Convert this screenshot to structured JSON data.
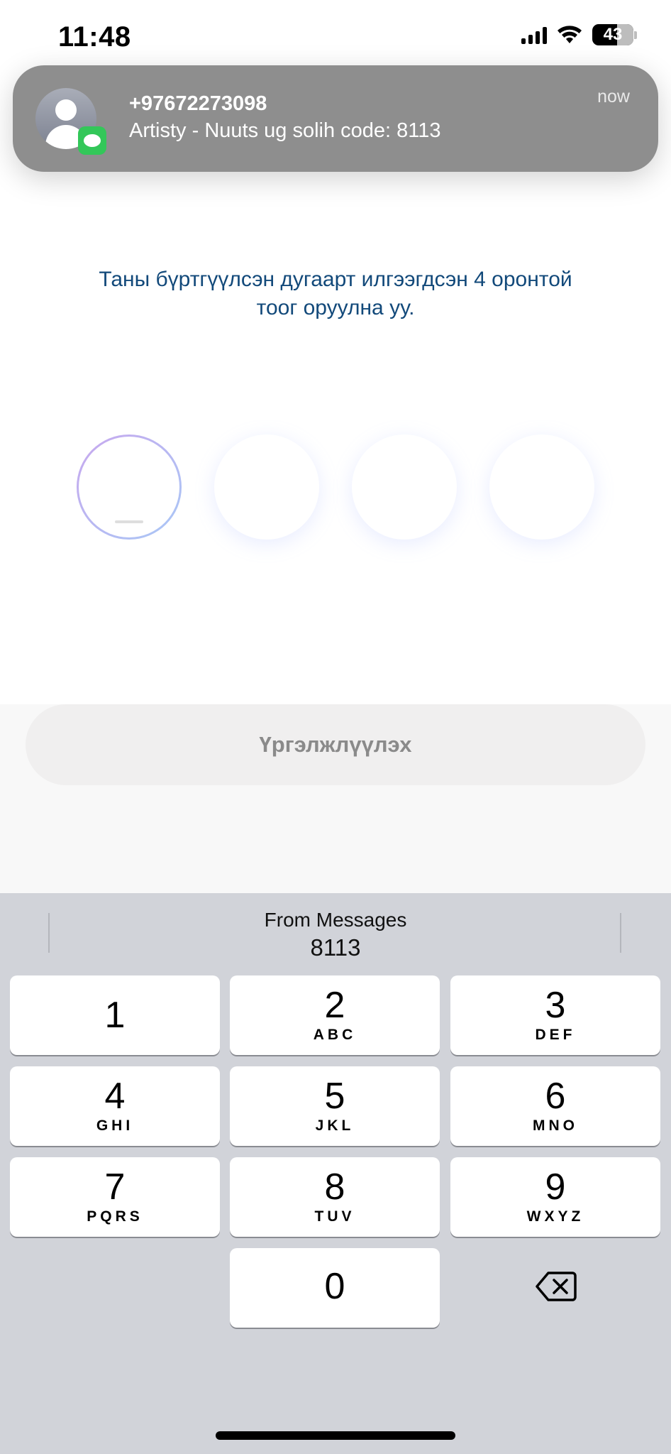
{
  "status_bar": {
    "time": "11:48",
    "battery": "43"
  },
  "notification": {
    "sender": "+97672273098",
    "message": "Artisty - Nuuts ug solih code: 8113",
    "time": "now"
  },
  "instruction": "Таны бүртгүүлсэн дугаарт илгээгдсэн 4 оронтой тоог оруулна уу.",
  "otp": {
    "digits": [
      "",
      "",
      "",
      ""
    ],
    "active_index": 0
  },
  "continue_label": "Үргэлжлүүлэх",
  "keyboard": {
    "suggestion_source": "From Messages",
    "suggestion_code": "8113",
    "keys": [
      {
        "digit": "1",
        "letters": ""
      },
      {
        "digit": "2",
        "letters": "ABC"
      },
      {
        "digit": "3",
        "letters": "DEF"
      },
      {
        "digit": "4",
        "letters": "GHI"
      },
      {
        "digit": "5",
        "letters": "JKL"
      },
      {
        "digit": "6",
        "letters": "MNO"
      },
      {
        "digit": "7",
        "letters": "PQRS"
      },
      {
        "digit": "8",
        "letters": "TUV"
      },
      {
        "digit": "9",
        "letters": "WXYZ"
      },
      {
        "digit": "0",
        "letters": ""
      }
    ]
  }
}
